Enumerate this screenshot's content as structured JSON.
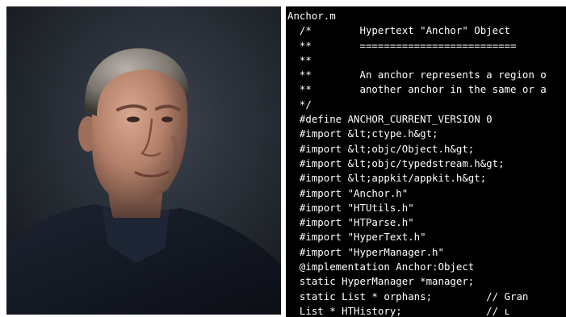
{
  "code": {
    "lines": [
      "Anchor.m",
      "  /*\t    Hypertext \"Anchor\" Object",
      "  **\t    ==========================",
      "  **",
      "  **\t    An anchor represents a region o",
      "  **\t    another anchor in the same or a",
      "  */",
      "  #define ANCHOR_CURRENT_VERSION 0",
      "  #import &lt;ctype.h&gt;",
      "  #import &lt;objc/Object.h&gt;",
      "  #import &lt;objc/typedstream.h&gt;",
      "  #import &lt;appkit/appkit.h&gt;",
      "  #import \"Anchor.h\"",
      "  #import \"HTUtils.h\"",
      "  #import \"HTParse.h\"",
      "  #import \"HyperText.h\"",
      "  #import \"HyperManager.h\"",
      "  @implementation Anchor:Object",
      "  static HyperManager *manager;",
      "  static List * orphans;         // Gran",
      "  List * HTHistory;              // ʟ"
    ]
  },
  "colors": {
    "code_background": "#000000",
    "code_text": "#ffffff",
    "photo_background": "#2a3038"
  }
}
